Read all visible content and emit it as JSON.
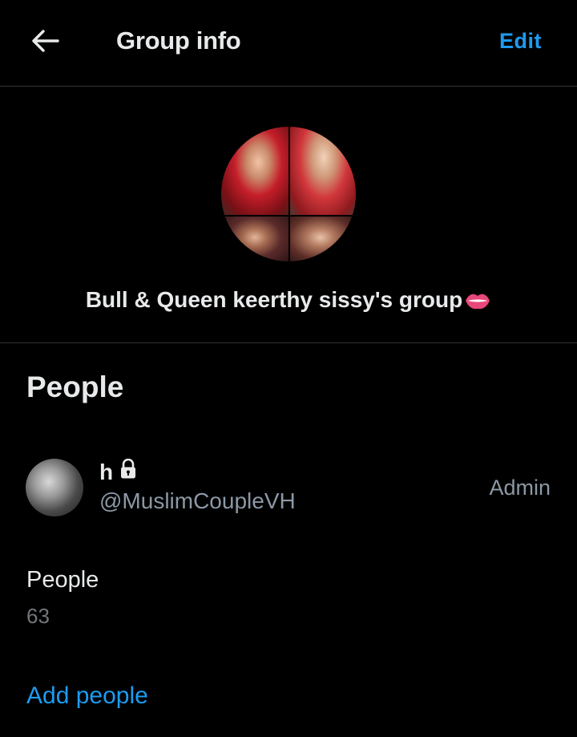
{
  "header": {
    "title": "Group info",
    "edit_label": "Edit",
    "back_icon": "arrow-left-icon"
  },
  "group": {
    "name": "Bull & Queen keerthy sissy's group",
    "name_emoji": "lips-icon",
    "avatar": "group-photo-collage"
  },
  "people": {
    "heading": "People",
    "members": [
      {
        "name": "h",
        "name_icon": "lock-icon",
        "handle": "@MuslimCoupleVH",
        "role": "Admin"
      }
    ],
    "count_label": "People",
    "count_value": "63",
    "add_label": "Add people"
  },
  "colors": {
    "background": "#000000",
    "accent": "#1d9bf0",
    "text_primary": "#e7e9ea",
    "text_secondary": "#8b98a5",
    "divider": "#2f3336"
  }
}
